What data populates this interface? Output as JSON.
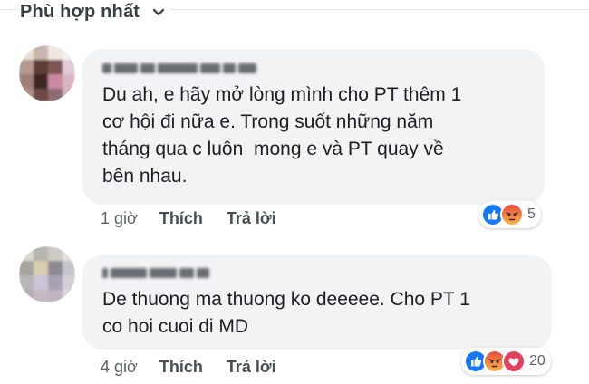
{
  "sort": {
    "label": "Phù hợp nhất",
    "icon": "chevron-down-icon"
  },
  "comments": [
    {
      "text": "Du ah, e hãy mở lòng mình cho PT thêm 1\ncơ hội đi nữa e. Trong suốt những năm\ntháng qua c luôn  mong e và PT quay về\nbên nhau.",
      "time": "1 giờ",
      "like_label": "Thích",
      "reply_label": "Trả lời",
      "reactions": [
        "like-icon",
        "angry-icon"
      ],
      "reaction_count": "5"
    },
    {
      "text": "De thuong ma thuong ko deeeee. Cho PT 1\nco hoi cuoi di MD",
      "time": "4 giờ",
      "like_label": "Thích",
      "reply_label": "Trả lời",
      "reactions": [
        "like-icon",
        "angry-icon",
        "love-icon"
      ],
      "reaction_count": "20"
    }
  ],
  "colors": {
    "bubble": "#f2f3f5",
    "like_blue": "#1877f2",
    "angry_orange": "#f0752e",
    "love_red": "#e4405f"
  }
}
